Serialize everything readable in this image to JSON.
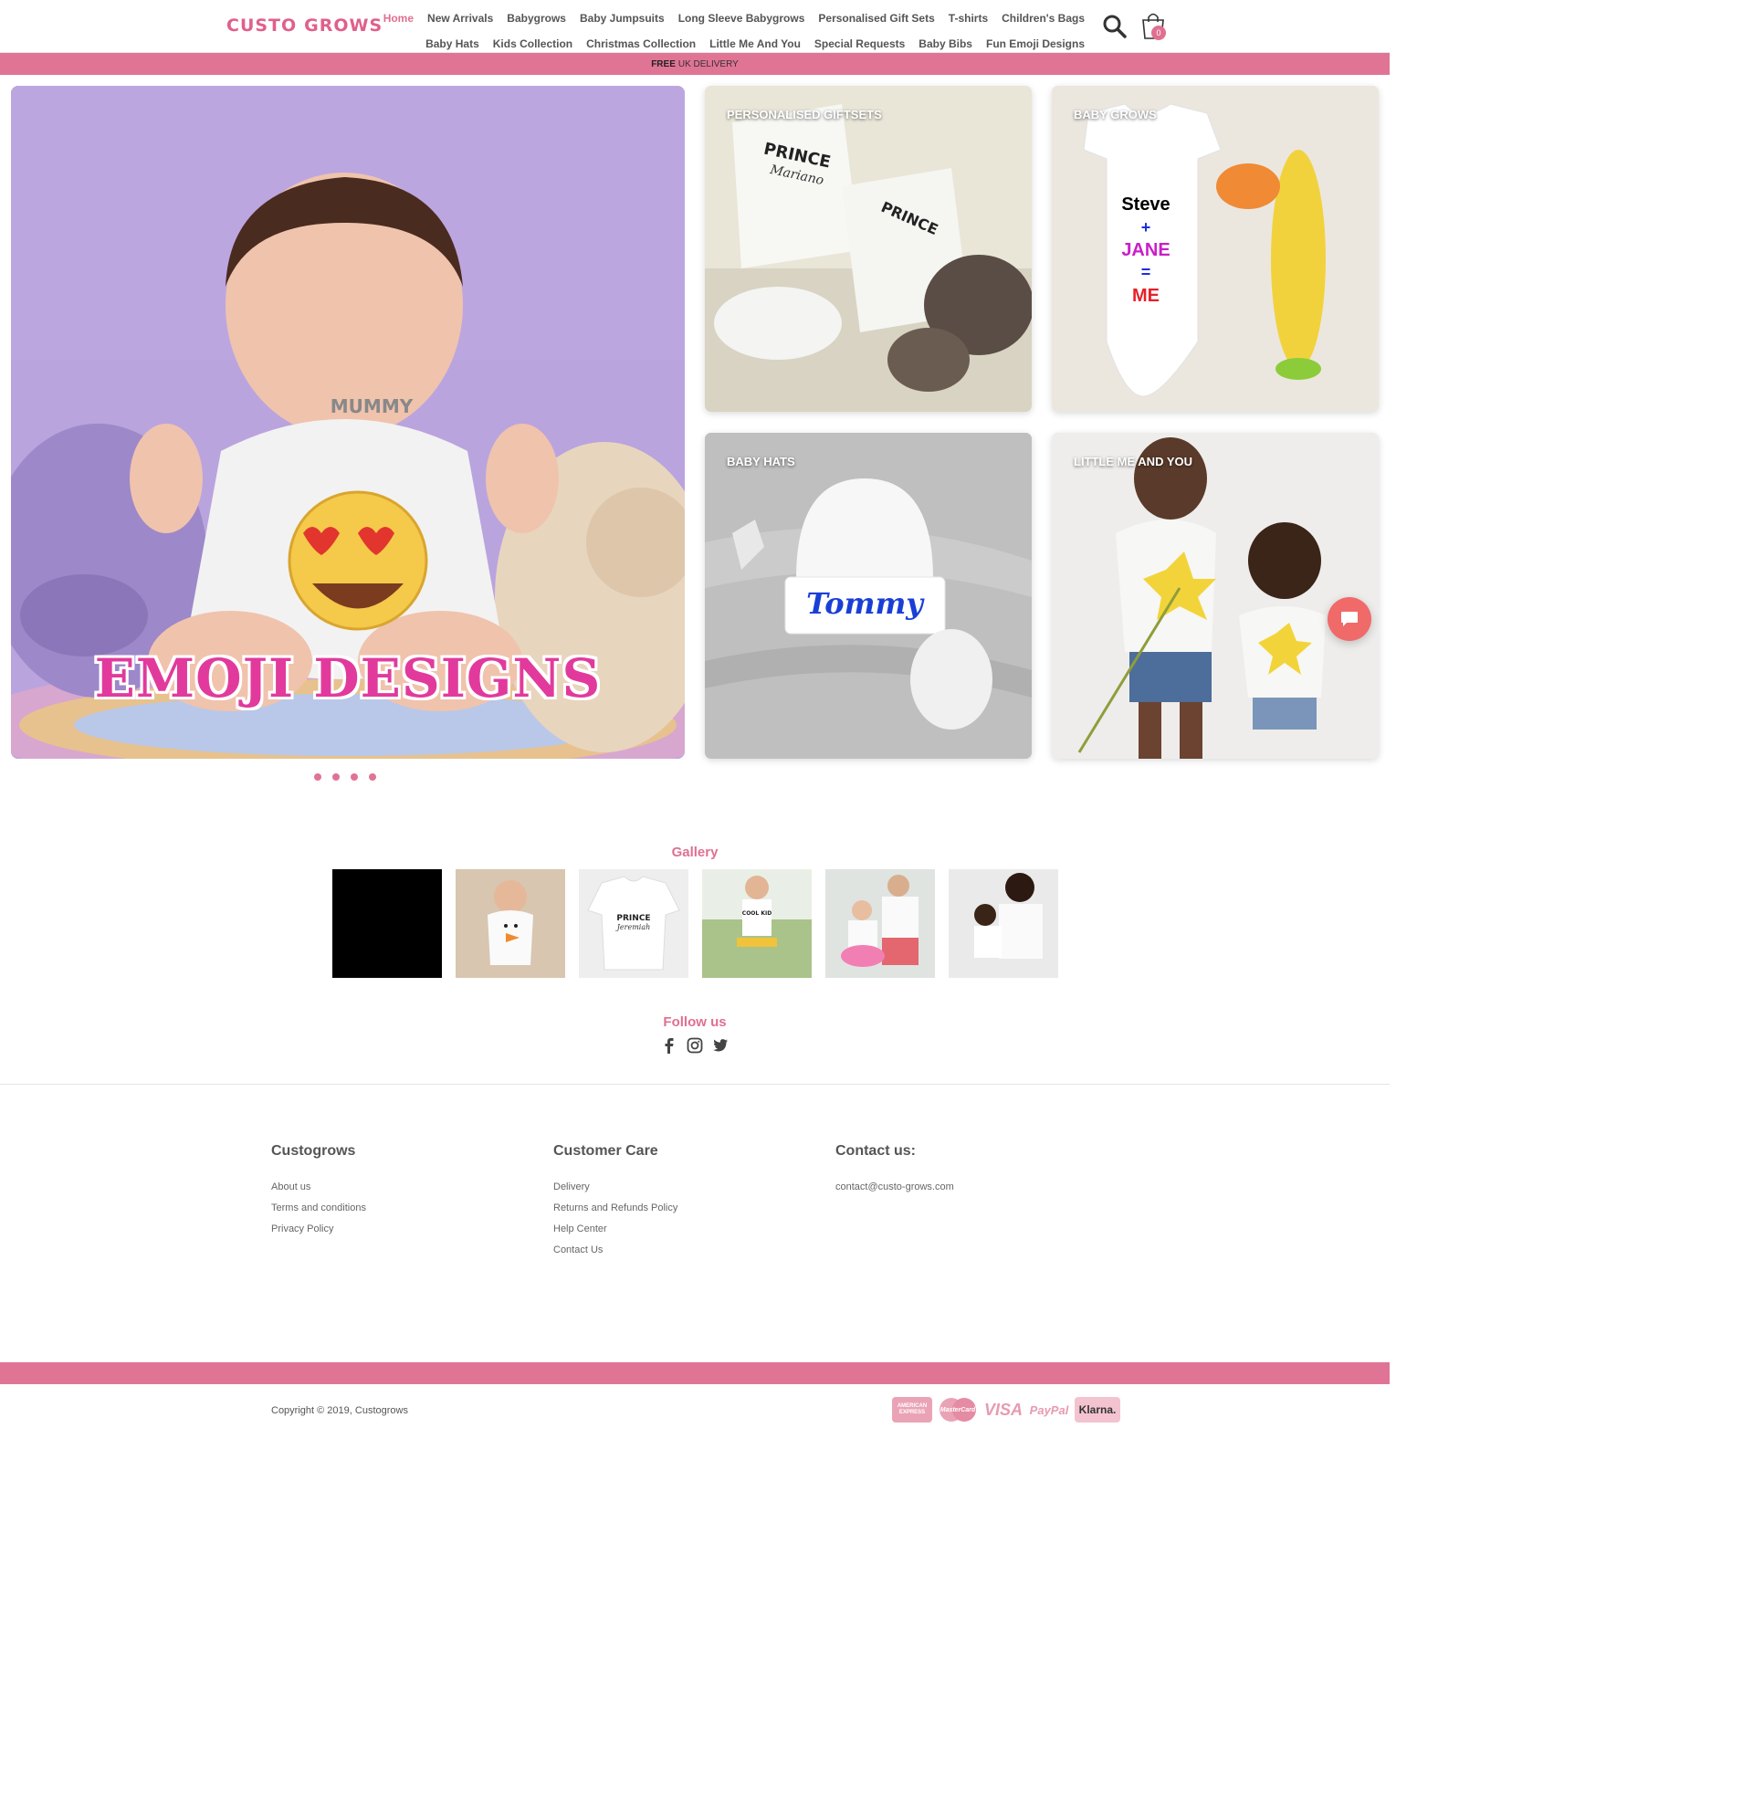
{
  "brand": {
    "logo_left": "CUSTO",
    "logo_right": "GROWS",
    "colors": {
      "accent": "#e07494",
      "active_nav": "#e07090",
      "hero_title": "#e13a9c"
    }
  },
  "nav": {
    "row1": [
      "Home",
      "New Arrivals",
      "Babygrows",
      "Baby Jumpsuits",
      "Long Sleeve Babygrows",
      "Personalised Gift Sets",
      "T-shirts",
      "Children's Bags"
    ],
    "row2": [
      "Baby Hats",
      "Kids Collection",
      "Christmas Collection",
      "Little Me And You",
      "Special Requests",
      "Baby Bibs",
      "Fun Emoji Designs"
    ],
    "active": "Home"
  },
  "cart": {
    "count": "0"
  },
  "promo": {
    "bold": "FREE",
    "text": "UK DELIVERY"
  },
  "hero": {
    "shirt_text": "MUMMY",
    "title": "EMOJI DESIGNS",
    "slide_count": 4
  },
  "tiles": [
    {
      "label": "PERSONALISED GIFTSETS",
      "print_1": "PRINCE",
      "print_2": "Mariano"
    },
    {
      "label": "BABY GROWS",
      "line1": "Steve",
      "line2": "+",
      "line3": "JANE",
      "line4": "=",
      "line5": "ME"
    },
    {
      "label": "BABY HATS",
      "print": "Tommy"
    },
    {
      "label": "LITTLE ME AND YOU"
    }
  ],
  "gallery": {
    "title": "Gallery",
    "item3_text_1": "PRINCE",
    "item3_text_2": "Jeremiah",
    "item4_text": "COOL KID"
  },
  "follow": {
    "title": "Follow us",
    "icons": [
      "facebook-icon",
      "instagram-icon",
      "twitter-icon"
    ]
  },
  "footer": {
    "col1": {
      "heading": "Custogrows",
      "links": [
        "About us",
        "Terms and conditions",
        "Privacy Policy"
      ]
    },
    "col2": {
      "heading": "Customer Care",
      "links": [
        "Delivery",
        "Returns and Refunds Policy",
        "Help Center",
        "Contact Us"
      ]
    },
    "col3": {
      "heading": "Contact us:",
      "links": [
        "contact@custo-grows.com"
      ]
    },
    "copyright": "Copyright © 2019, Custogrows",
    "payments": [
      "AMERICAN EXPRESS",
      "MasterCard",
      "VISA",
      "PayPal",
      "Klarna."
    ]
  }
}
